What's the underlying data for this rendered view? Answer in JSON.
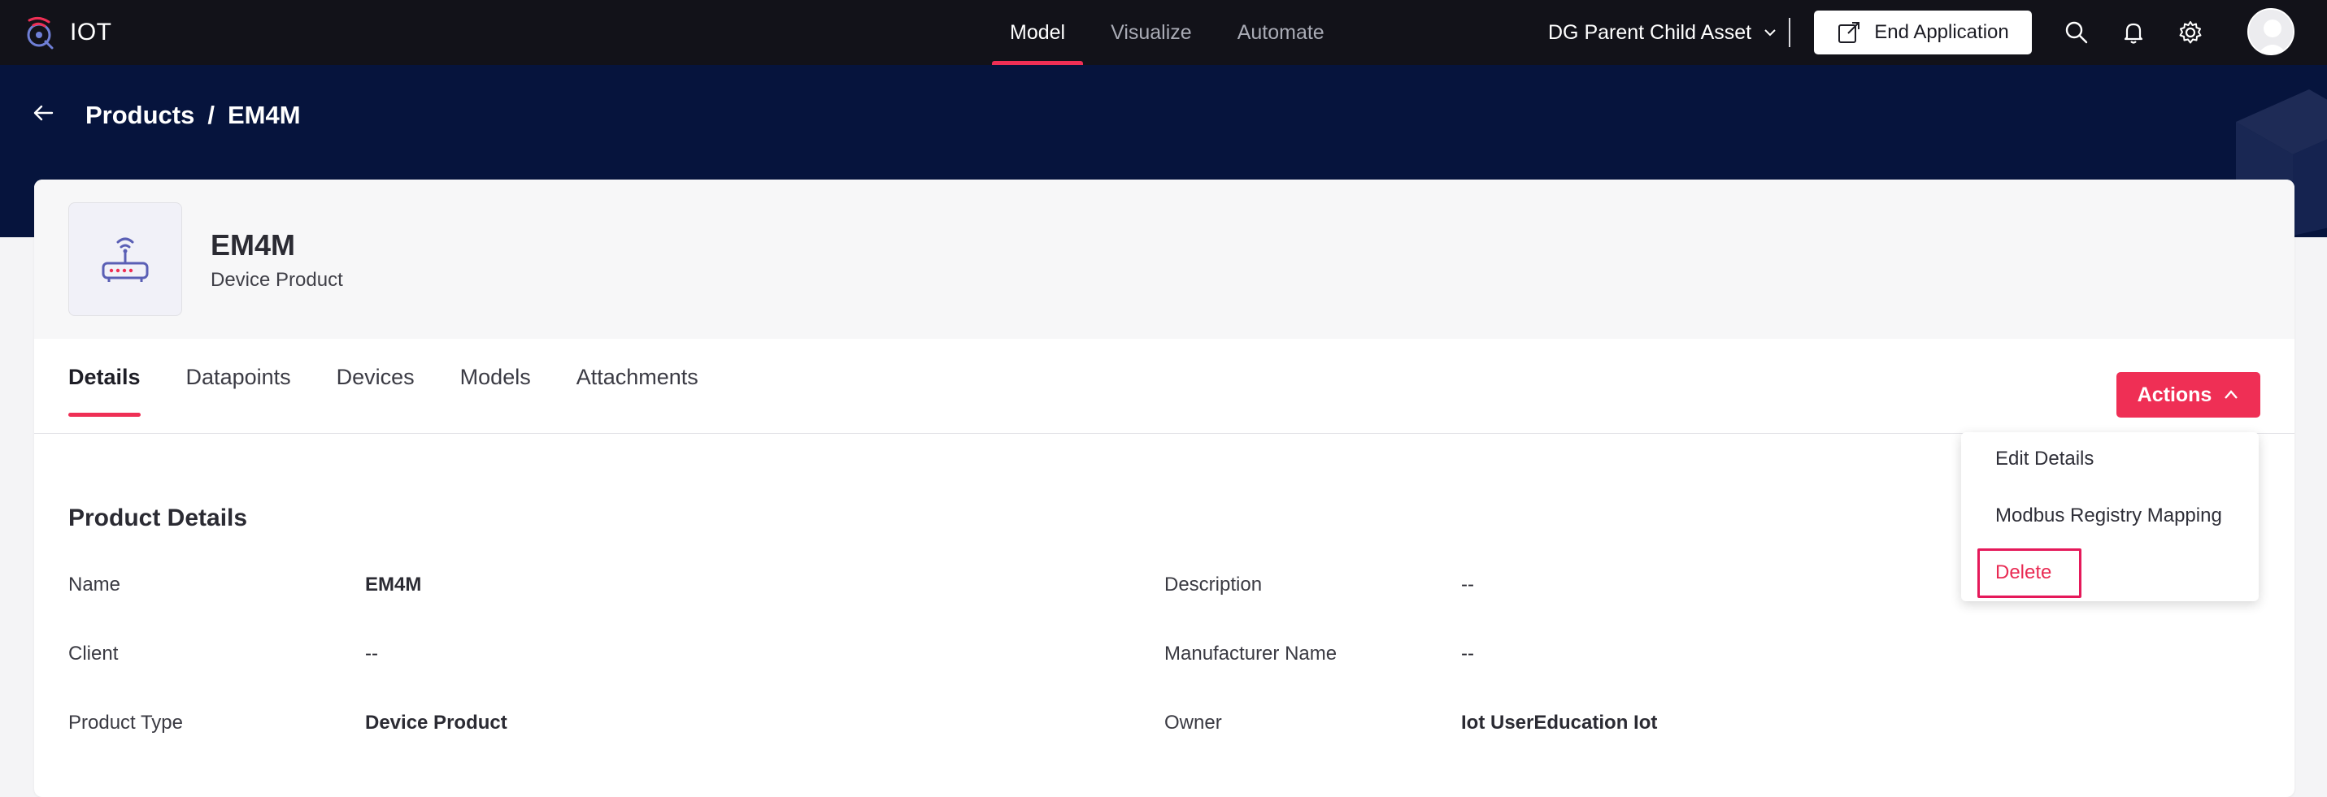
{
  "topnav": {
    "brand": "IOT",
    "tabs": [
      {
        "label": "Model",
        "active": true
      },
      {
        "label": "Visualize",
        "active": false
      },
      {
        "label": "Automate",
        "active": false
      }
    ],
    "app_selector": "DG Parent Child Asset",
    "end_application": "End Application",
    "icons": [
      "search-icon",
      "bell-icon",
      "gear-icon",
      "avatar"
    ]
  },
  "header": {
    "breadcrumb_parent": "Products",
    "breadcrumb_separator": "/",
    "breadcrumb_current": "EM4M"
  },
  "product": {
    "name": "EM4M",
    "type": "Device Product",
    "icon": "router-icon"
  },
  "tabs": [
    {
      "label": "Details",
      "active": true
    },
    {
      "label": "Datapoints",
      "active": false
    },
    {
      "label": "Devices",
      "active": false
    },
    {
      "label": "Models",
      "active": false
    },
    {
      "label": "Attachments",
      "active": false
    }
  ],
  "actions": {
    "label": "Actions",
    "menu": [
      "Edit Details",
      "Modbus Registry Mapping",
      "Delete"
    ]
  },
  "details": {
    "section_title": "Product Details",
    "fields": [
      {
        "label": "Name",
        "value": "EM4M"
      },
      {
        "label": "Description",
        "value": "--"
      },
      {
        "label": "Client",
        "value": "--"
      },
      {
        "label": "Manufacturer Name",
        "value": "--"
      },
      {
        "label": "Product Type",
        "value": "Device Product"
      },
      {
        "label": "Owner",
        "value": "Iot UserEducation Iot"
      }
    ]
  },
  "colors": {
    "nav_bg": "#121219",
    "header_bg": "#06143d",
    "accent": "#ef2f55",
    "highlight": "#e5195a"
  }
}
